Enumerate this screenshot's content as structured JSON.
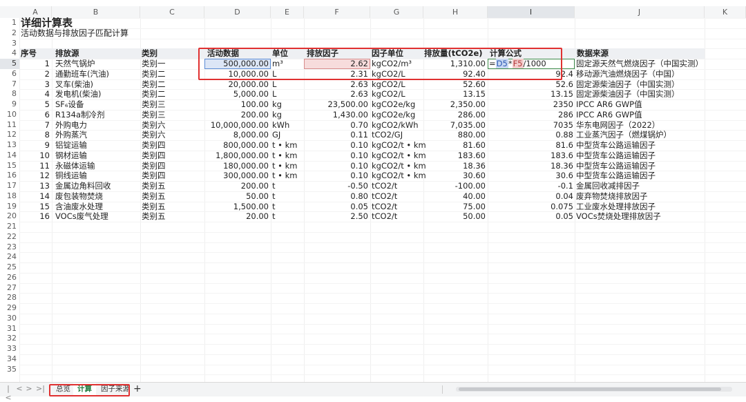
{
  "columns": [
    "A",
    "B",
    "C",
    "D",
    "E",
    "F",
    "G",
    "H",
    "I",
    "J",
    "K"
  ],
  "selected_column": "I",
  "selected_row": 5,
  "title": "详细计算表",
  "subtitle": "活动数据与排放因子匹配计算",
  "headers": {
    "seq": "序号",
    "source": "排放源",
    "category": "类别",
    "activity": "活动数据",
    "unit": "单位",
    "factor": "排放因子",
    "factor_unit": "因子单位",
    "emission": "排放量(tCO2e)",
    "formula": "计算公式",
    "data_source": "数据来源"
  },
  "formula_parts": {
    "eq": "=",
    "ref1": "D5",
    "op": "*",
    "ref2": "F5",
    "rest": "/1000"
  },
  "rows": [
    {
      "no": "1",
      "src": "天然气锅炉",
      "cat": "类别一",
      "act": "500,000.00",
      "unit": "m³",
      "fac": "2.62",
      "funit": "kgCO2/m³",
      "em": "1,310.00",
      "f": "",
      "ds": "固定源天然气燃烧因子（中国实测）"
    },
    {
      "no": "2",
      "src": "通勤班车(汽油)",
      "cat": "类别二",
      "act": "10,000.00",
      "unit": "L",
      "fac": "2.31",
      "funit": "kgCO2/L",
      "em": "92.40",
      "f": "92.4",
      "ds": "移动源汽油燃烧因子（中国）"
    },
    {
      "no": "3",
      "src": "叉车(柴油)",
      "cat": "类别二",
      "act": "20,000.00",
      "unit": "L",
      "fac": "2.63",
      "funit": "kgCO2/L",
      "em": "52.60",
      "f": "52.6",
      "ds": "固定源柴油因子（中国实测）"
    },
    {
      "no": "4",
      "src": "发电机(柴油)",
      "cat": "类别二",
      "act": "5,000.00",
      "unit": "L",
      "fac": "2.63",
      "funit": "kgCO2/L",
      "em": "13.15",
      "f": "13.15",
      "ds": "固定源柴油因子（中国实测）"
    },
    {
      "no": "5",
      "src": "SF₆设备",
      "cat": "类别三",
      "act": "100.00",
      "unit": "kg",
      "fac": "23,500.00",
      "funit": "kgCO2e/kg",
      "em": "2,350.00",
      "f": "2350",
      "ds": "IPCC AR6 GWP值"
    },
    {
      "no": "6",
      "src": "R134a制冷剂",
      "cat": "类别三",
      "act": "200.00",
      "unit": "kg",
      "fac": "1,430.00",
      "funit": "kgCO2e/kg",
      "em": "286.00",
      "f": "286",
      "ds": "IPCC AR6 GWP值"
    },
    {
      "no": "7",
      "src": "外购电力",
      "cat": "类别六",
      "act": "10,000,000.00",
      "unit": "kWh",
      "fac": "0.70",
      "funit": "kgCO2/kWh",
      "em": "7,035.00",
      "f": "7035",
      "ds": "华东电网因子（2022）"
    },
    {
      "no": "8",
      "src": "外购蒸汽",
      "cat": "类别六",
      "act": "8,000.00",
      "unit": "GJ",
      "fac": "0.11",
      "funit": "tCO2/GJ",
      "em": "880.00",
      "f": "0.88",
      "ds": "工业蒸汽因子（燃煤锅炉）"
    },
    {
      "no": "9",
      "src": "铝锭运输",
      "cat": "类别四",
      "act": "800,000.00",
      "unit": "t • km",
      "fac": "0.10",
      "funit": "kgCO2/t • km",
      "em": "81.60",
      "f": "81.6",
      "ds": "中型货车公路运输因子"
    },
    {
      "no": "10",
      "src": "钢材运输",
      "cat": "类别四",
      "act": "1,800,000.00",
      "unit": "t • km",
      "fac": "0.10",
      "funit": "kgCO2/t • km",
      "em": "183.60",
      "f": "183.6",
      "ds": "中型货车公路运输因子"
    },
    {
      "no": "11",
      "src": "永磁体运输",
      "cat": "类别四",
      "act": "180,000.00",
      "unit": "t • km",
      "fac": "0.10",
      "funit": "kgCO2/t • km",
      "em": "18.36",
      "f": "18.36",
      "ds": "中型货车公路运输因子"
    },
    {
      "no": "12",
      "src": "铜线运输",
      "cat": "类别四",
      "act": "300,000.00",
      "unit": "t • km",
      "fac": "0.10",
      "funit": "kgCO2/t • km",
      "em": "30.60",
      "f": "30.6",
      "ds": "中型货车公路运输因子"
    },
    {
      "no": "13",
      "src": "金属边角料回收",
      "cat": "类别五",
      "act": "200.00",
      "unit": "t",
      "fac": "-0.50",
      "funit": "tCO2/t",
      "em": "-100.00",
      "f": "-0.1",
      "ds": "金属回收减排因子"
    },
    {
      "no": "14",
      "src": "废包装物焚烧",
      "cat": "类别五",
      "act": "50.00",
      "unit": "t",
      "fac": "0.80",
      "funit": "tCO2/t",
      "em": "40.00",
      "f": "0.04",
      "ds": "废弃物焚烧排放因子"
    },
    {
      "no": "15",
      "src": "含油废水处理",
      "cat": "类别五",
      "act": "1,500.00",
      "unit": "t",
      "fac": "0.05",
      "funit": "tCO2/t",
      "em": "75.00",
      "f": "0.075",
      "ds": "工业废水处理排放因子"
    },
    {
      "no": "16",
      "src": "VOCs废气处理",
      "cat": "类别五",
      "act": "20.00",
      "unit": "t",
      "fac": "2.50",
      "funit": "tCO2/t",
      "em": "50.00",
      "f": "0.05",
      "ds": "VOCs焚烧处理排放因子"
    }
  ],
  "row_numbers": [
    "1",
    "2",
    "3",
    "4",
    "5",
    "6",
    "7",
    "8",
    "9",
    "10",
    "11",
    "12",
    "13",
    "14",
    "15",
    "16",
    "17",
    "18",
    "19",
    "20",
    "21",
    "22",
    "23",
    "24",
    "25",
    "26",
    "27",
    "28",
    "29",
    "30",
    "31",
    "32",
    "33",
    "34",
    "35"
  ],
  "tabs": [
    "总览",
    "计算",
    "因子来源"
  ],
  "active_tab": "计算",
  "tab_add": "+",
  "nav": [
    "|<",
    "<",
    ">",
    ">|"
  ],
  "colors": {
    "accent": "#1d7a3c",
    "highlight_red": "#e03030",
    "ref_blue": "#2b58b3",
    "ref_red": "#b33a3a"
  }
}
